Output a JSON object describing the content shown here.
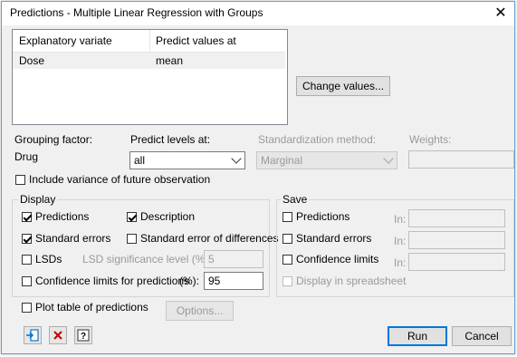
{
  "window": {
    "title": "Predictions - Multiple Linear Regression with Groups",
    "close_glyph": "✕"
  },
  "table": {
    "headers": [
      "Explanatory variate",
      "Predict values at"
    ],
    "rows": [
      {
        "variate": "Dose",
        "value": "mean"
      }
    ]
  },
  "change_values_label": "Change values...",
  "grouping": {
    "label": "Grouping factor:",
    "value": "Drug"
  },
  "predict_levels": {
    "label": "Predict levels at:",
    "value": "all"
  },
  "standardization": {
    "label": "Standardization method:",
    "value": "Marginal"
  },
  "weights": {
    "label": "Weights:",
    "value": ""
  },
  "include_variance": {
    "label": "Include variance of future observation",
    "checked": false
  },
  "display": {
    "title": "Display",
    "predictions": {
      "label": "Predictions",
      "checked": true
    },
    "description": {
      "label": "Description",
      "checked": true
    },
    "standard_errors": {
      "label": "Standard errors",
      "checked": true
    },
    "sed": {
      "label": "Standard error of differences",
      "checked": false
    },
    "lsds": {
      "label": "LSDs",
      "checked": false
    },
    "lsd_level": {
      "label": "LSD significance level (%):",
      "value": "5"
    },
    "confidence_limits": {
      "label": "Confidence limits for predictions",
      "checked": false
    },
    "pct": {
      "label": "(%):",
      "value": "95"
    }
  },
  "save": {
    "title": "Save",
    "in_label": "In:",
    "predictions": {
      "label": "Predictions",
      "checked": false
    },
    "standard_errors": {
      "label": "Standard errors",
      "checked": false
    },
    "confidence_limits": {
      "label": "Confidence limits",
      "checked": false
    },
    "display_in_spreadsheet": {
      "label": "Display in spreadsheet",
      "checked": false
    }
  },
  "plot_table": {
    "label": "Plot table of predictions",
    "checked": false
  },
  "options_label": "Options...",
  "run_label": "Run",
  "cancel_label": "Cancel",
  "icons": {
    "accent": "#0078d7",
    "clear_color": "#c00000"
  }
}
